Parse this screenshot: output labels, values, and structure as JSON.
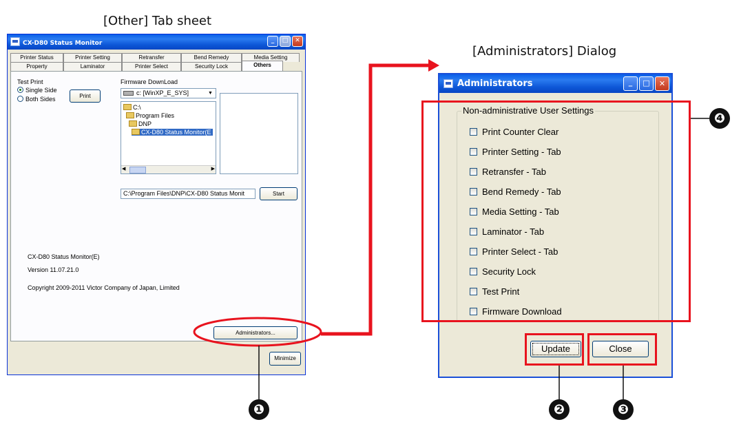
{
  "captions": {
    "left": "[Other] Tab sheet",
    "right": "[Administrators] Dialog"
  },
  "left_window": {
    "title": "CX-D80 Status Monitor",
    "tabs_row1": [
      "Printer Status",
      "Printer Setting",
      "Retransfer",
      "Bend Remedy",
      "Media Setting"
    ],
    "tabs_row2": [
      "Property",
      "Laminator",
      "Printer Select",
      "Security Lock",
      "Others"
    ],
    "active_tab": "Others",
    "test_print": {
      "label": "Test Print",
      "single_side": "Single Side",
      "both_sides": "Both Sides",
      "print_button": "Print"
    },
    "firmware": {
      "label": "Firmware DownLoad",
      "drive": "c: [WinXP_E_SYS]",
      "folders": [
        "C:\\",
        "Program Files",
        "DNP",
        "CX-D80 Status Monitor(E"
      ],
      "path": "C:\\Program Files\\DNP\\CX-D80 Status Monit",
      "start_button": "Start"
    },
    "app_name": "CX-D80 Status Monitor(E)",
    "version": "Version 11.07.21.0",
    "copyright": "Copyright 2009-2011 Victor Company of Japan, Limited",
    "administrators_button": "Administrators...",
    "minimize_button": "Minimize"
  },
  "admin_dialog": {
    "title": "Administrators",
    "group_label": "Non-administrative User Settings",
    "checkboxes": [
      "Print Counter Clear",
      "Printer Setting - Tab",
      "Retransfer - Tab",
      "Bend Remedy - Tab",
      "Media Setting - Tab",
      "Laminator - Tab",
      "Printer Select - Tab",
      "Security Lock",
      "Test Print",
      "Firmware Download"
    ],
    "update_button": "Update",
    "close_button": "Close"
  },
  "callouts": [
    "❶",
    "❷",
    "❸",
    "❹"
  ],
  "colors": {
    "highlight": "#e8131e",
    "titlebar": "#0a5fe8"
  }
}
